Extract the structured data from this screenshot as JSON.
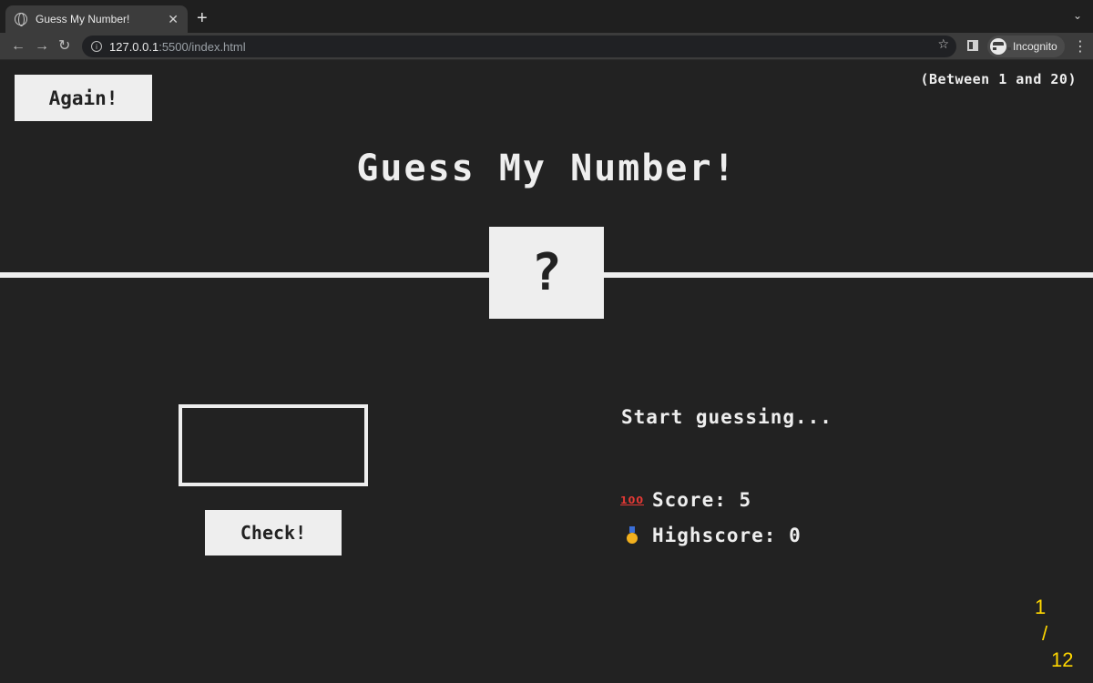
{
  "browser": {
    "tab_title": "Guess My Number!",
    "tab_close": "✕",
    "new_tab": "+",
    "tab_dropdown": "⌄",
    "nav": {
      "back": "←",
      "forward": "→",
      "reload": "↻"
    },
    "url_host": "127.0.0.1",
    "url_path": ":5500/index.html",
    "bookmark_icon": "☆",
    "incognito_label": "Incognito",
    "menu": "⋮"
  },
  "game": {
    "again_label": "Again!",
    "range_hint": "(Between 1 and 20)",
    "title": "Guess My Number!",
    "secret_display": "?",
    "guess_value": "",
    "check_label": "Check!",
    "message": "Start guessing...",
    "score_label": "Score:",
    "score_value": "5",
    "highscore_label": "Highscore:",
    "highscore_value": "0",
    "score_icon": "100",
    "colors": {
      "background": "#222222",
      "foreground": "#eeeeee",
      "pager": "#ffd700"
    }
  },
  "pager": {
    "current": "1",
    "separator": "/",
    "total": "12"
  }
}
